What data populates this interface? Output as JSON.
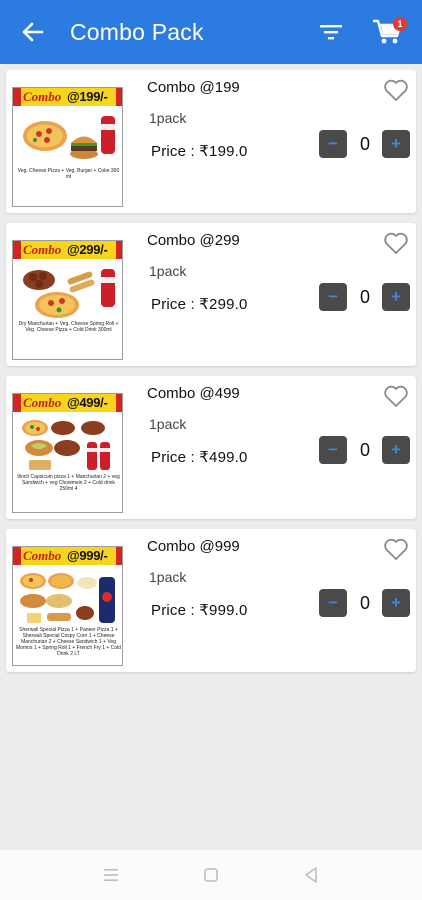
{
  "appbar": {
    "title": "Combo Pack",
    "cart_count": "1",
    "accent_color": "#2c7be0",
    "icons": [
      "arrow-back-icon",
      "filter-icon",
      "cart-icon"
    ]
  },
  "products": [
    {
      "name": "Combo @199",
      "pack": "1pack",
      "price": "Price : ₹199.0",
      "count": "0",
      "thumb_label": "Combo",
      "thumb_price": "@199/-",
      "thumb_caption": "Veg. Cheese Pizza + Veg. Burger + Coke 300 ml",
      "veg": true
    },
    {
      "name": "Combo @299",
      "pack": "1pack",
      "price": "Price : ₹299.0",
      "count": "0",
      "thumb_label": "Combo",
      "thumb_price": "@299/-",
      "thumb_caption": "Dry Manchurian + Veg. Cheese Spring Roll + Veg. Cheese Pizza + Cold Drink 300ml",
      "veg": true
    },
    {
      "name": "Combo @499",
      "pack": "1pack",
      "price": "Price : ₹499.0",
      "count": "0",
      "thumb_label": "Combo",
      "thumb_price": "@499/-",
      "thumb_caption": "9inch Capsicum pizza 1 + Manchurian 2 + veg Sandwich + veg Chowmein 2 + Cold drink 250ml 4",
      "veg": true
    },
    {
      "name": "Combo @999",
      "pack": "1pack",
      "price": "Price : ₹999.0",
      "count": "0",
      "thumb_label": "Combo",
      "thumb_price": "@999/-",
      "thumb_caption": "Sherwali Special Pizza 1 + Paneer Pizza 1 + Sherwali Special Crispy Corn 1 + Cheese Manchurian 2 + Cheese Sandwich 1 + Veg Momos 1 + Spring Roll 1 + French Fry 1 + Cold Drink 2 LT",
      "veg": true
    }
  ],
  "controls": {
    "minus_symbol": "−",
    "plus_symbol": "+"
  },
  "navbar": {
    "icons": [
      "menu-icon",
      "home-square-icon",
      "back-triangle-icon"
    ]
  }
}
